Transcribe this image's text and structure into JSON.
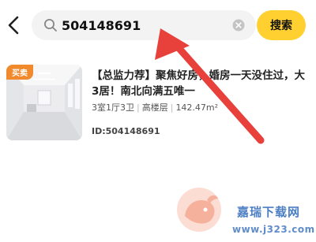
{
  "header": {
    "back_icon": "chevron-left-icon",
    "search_icon": "search-icon",
    "search_value": "504148691",
    "clear_icon": "clear-circle-icon",
    "search_button_label": "搜索",
    "accent_color": "#ffd02f"
  },
  "result": {
    "badge": "买卖",
    "badge_color": "#f08a2c",
    "title": "【总监力荐】聚焦好房，婚房一天没住过，大3居！南北向满五唯一",
    "meta": {
      "layout": "3室1厅3卫",
      "floor": "高楼层",
      "area": "142.47m²",
      "separator": "|"
    },
    "listing_id": "ID:504148691"
  },
  "annotation": {
    "arrow_color": "#e8403a"
  },
  "watermark": {
    "text": "嘉瑞下载网",
    "url": "www.j323.com"
  }
}
